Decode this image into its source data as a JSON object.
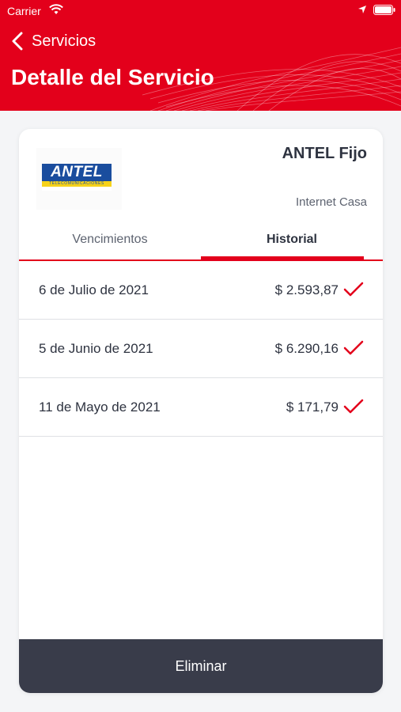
{
  "status_bar": {
    "carrier": "Carrier"
  },
  "nav": {
    "back_label": "Servicios",
    "title": "Detalle del Servicio"
  },
  "service": {
    "logo_text": "ANTEL",
    "logo_subtext": "TELECOMUNICACIONES",
    "name": "ANTEL Fijo",
    "description": "Internet Casa"
  },
  "tabs": [
    {
      "label": "Vencimientos",
      "active": false
    },
    {
      "label": "Historial",
      "active": true
    }
  ],
  "history": [
    {
      "date": "6 de Julio de 2021",
      "amount": "$ 2.593,87",
      "paid": true
    },
    {
      "date": "5 de Junio de 2021",
      "amount": "$ 6.290,16",
      "paid": true
    },
    {
      "date": "11 de Mayo de 2021",
      "amount": "$ 171,79",
      "paid": true
    }
  ],
  "actions": {
    "delete_label": "Eliminar"
  },
  "colors": {
    "accent": "#e3001b",
    "dark_button": "#393c4a",
    "text": "#2e3340"
  }
}
